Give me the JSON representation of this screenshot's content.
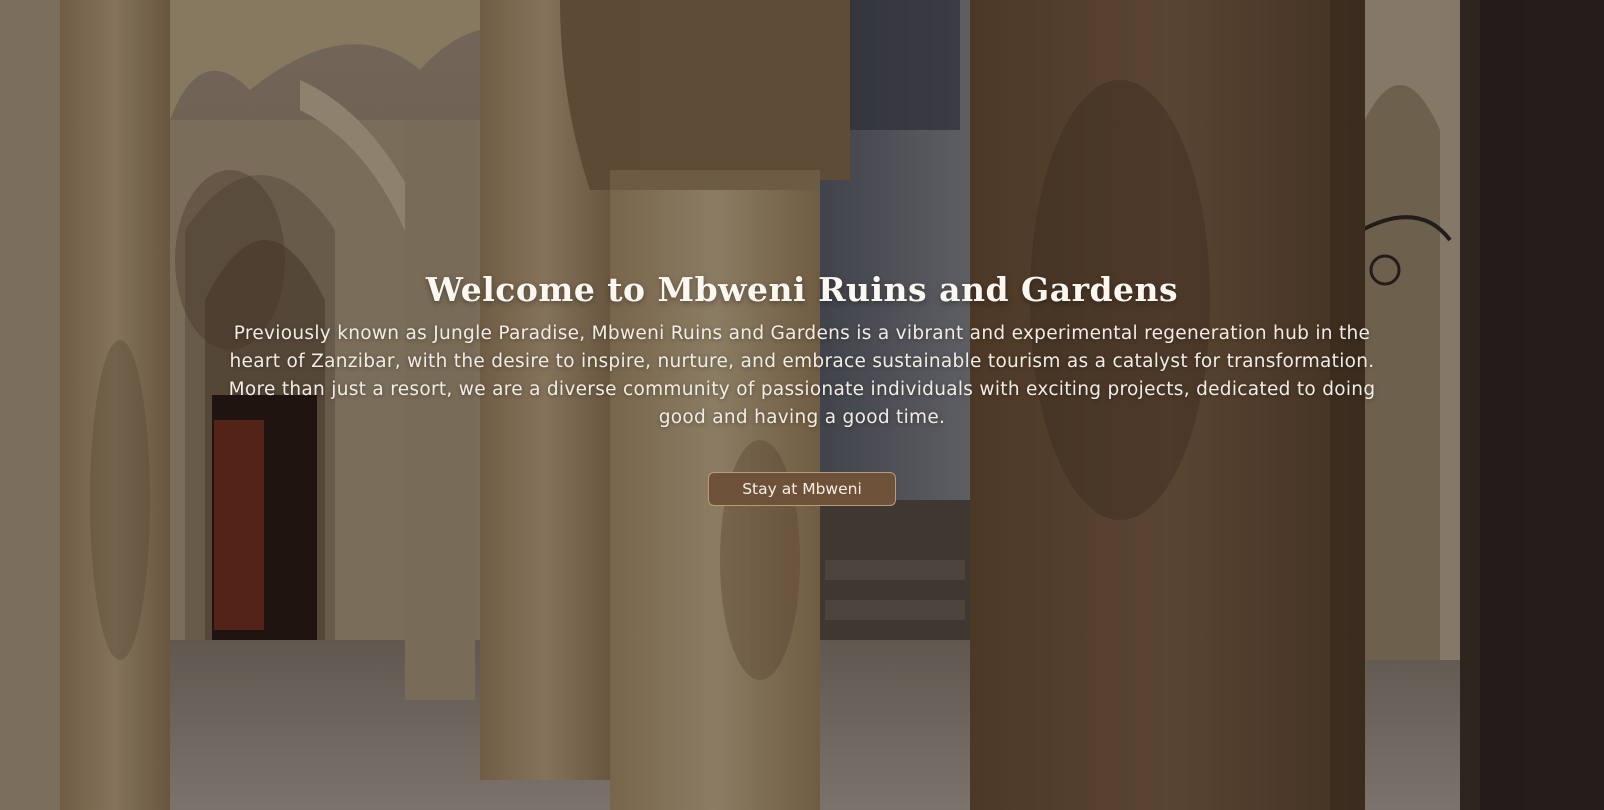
{
  "hero": {
    "title": "Welcome to Mbweni Ruins and Gardens",
    "intro": "Previously known as Jungle Paradise, Mbweni Ruins and Gardens is a vibrant and experimental regeneration hub in the heart of Zanzibar, with the desire to inspire, nurture, and embrace sustainable tourism as a catalyst for transformation. More than just a resort, we are a diverse community of passionate individuals with exciting projects, dedicated to doing good and having a good time.",
    "cta_label": "Stay at Mbweni"
  },
  "colors": {
    "button_bg": "#6e5139",
    "button_border": "#b89a7c",
    "text": "#f6f1ea"
  }
}
